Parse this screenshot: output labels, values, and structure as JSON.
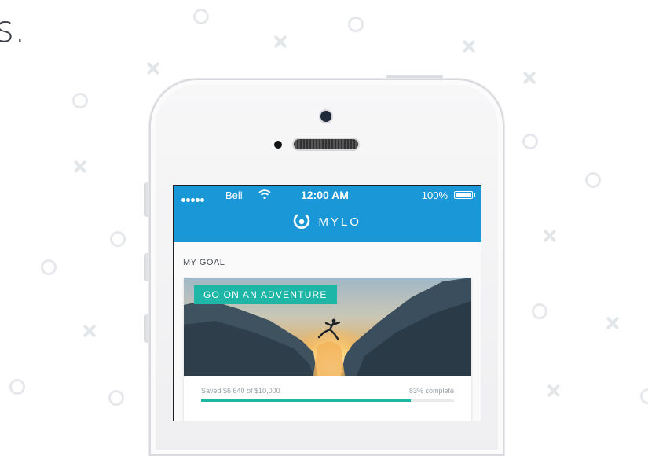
{
  "background": {
    "corner_text": "s."
  },
  "status_bar": {
    "carrier": "Bell",
    "time": "12:00 AM",
    "battery": "100%"
  },
  "app": {
    "brand_name": "MYLO",
    "accent_color": "#1a97d6"
  },
  "goal": {
    "section_title": "MY GOAL",
    "tag_label": "GO ON AN ADVENTURE",
    "saved_text": "Saved $6,640 of $10,000",
    "complete_text": "83% complete",
    "progress_fraction": 0.83,
    "progress_color": "#1fb5a3"
  }
}
